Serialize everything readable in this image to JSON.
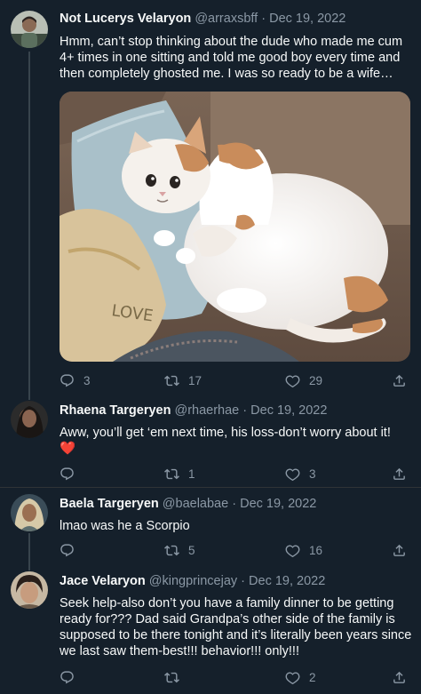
{
  "tweets": [
    {
      "name": "Not Lucerys Velaryon",
      "handle": "@arraxsbff",
      "sep": "·",
      "date": "Dec 19, 2022",
      "text": "Hmm, can’t stop thinking about the dude who made me cum 4+ times in one sitting and told me good boy every time and then completely ghosted me. I was so ready to be a wife…",
      "replies": "3",
      "retweets": "17",
      "likes": "29",
      "has_image": true
    },
    {
      "name": "Rhaena Targeryen",
      "handle": "@rhaerhae",
      "sep": "·",
      "date": "Dec 19, 2022",
      "text": "Aww, you’ll get ‘em next time, his loss-don’t worry about it!",
      "emoji": "❤️",
      "replies": "",
      "retweets": "1",
      "likes": "3"
    },
    {
      "name": "Baela Targeryen",
      "handle": "@baelabae",
      "sep": "·",
      "date": "Dec 19, 2022",
      "text": "lmao was he a Scorpio",
      "replies": "",
      "retweets": "5",
      "likes": "16"
    },
    {
      "name": "Jace Velaryon",
      "handle": "@kingprincejay",
      "sep": "·",
      "date": "Dec 19, 2022",
      "text": "Seek help-also don’t you have a family dinner to be getting ready for??? Dad said Grandpa’s other side of the family is supposed to be there tonight and it’s literally been years since we last saw them-best!!! behavior!!! only!!!",
      "replies": "",
      "retweets": "",
      "likes": "2"
    }
  ],
  "colors": {
    "background": "#15202b",
    "text_primary": "#f7f9f9",
    "text_secondary": "#8b98a5",
    "heart_red": "#e0245e"
  },
  "icons": {
    "reply": "reply-icon",
    "retweet": "retweet-icon",
    "like": "heart-icon",
    "share": "share-icon"
  }
}
